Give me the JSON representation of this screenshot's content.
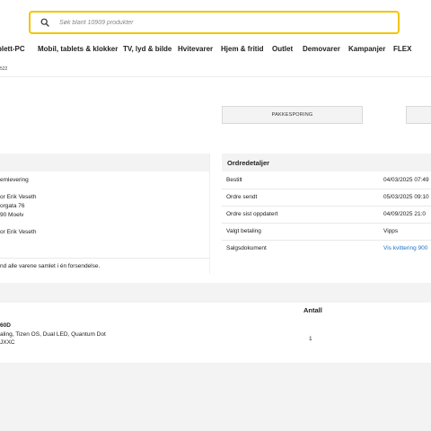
{
  "search": {
    "placeholder": "Søk blant 10909 produkter"
  },
  "nav": {
    "items": [
      "plett-PC",
      "Mobil, tablets & klokker",
      "TV, lyd & bilde",
      "Hvitevarer",
      "Hjem & fritid",
      "Outlet",
      "Demovarer",
      "Kampanjer",
      "FLEX"
    ]
  },
  "breadcrumb": {
    "text": "522"
  },
  "actions": {
    "tracking_label": "PAKKESPORING"
  },
  "delivery": {
    "method": "emlevering",
    "name": "or Erik Veseth",
    "street": "orgata 76",
    "city": "90 Moelv",
    "billing_name": "or Erik Veseth",
    "note": "nd alle varene samlet i én forsendelse."
  },
  "order_details": {
    "title": "Ordredetaljer",
    "rows": [
      {
        "label": "Bestilt",
        "value": "04/03/2025 07:49"
      },
      {
        "label": "Ordre sendt",
        "value": "05/03/2025 09:10"
      },
      {
        "label": "Ordre sist oppdatert",
        "value": "04/09/2025 21:0"
      },
      {
        "label": "Valgt betaling",
        "value": "Vipps"
      },
      {
        "label": "Salgsdokument",
        "value": "Vis kvittering 900"
      }
    ]
  },
  "products": {
    "qty_header": "Antall",
    "item": {
      "name": "60D",
      "desc": "aling, Tizen OS, Dual LED, Quantum Dot",
      "code": "JXXC",
      "qty": "1"
    }
  },
  "colors": {
    "accent": "#f2c400",
    "link": "#1a73c8",
    "panel": "#f3f3f3"
  }
}
